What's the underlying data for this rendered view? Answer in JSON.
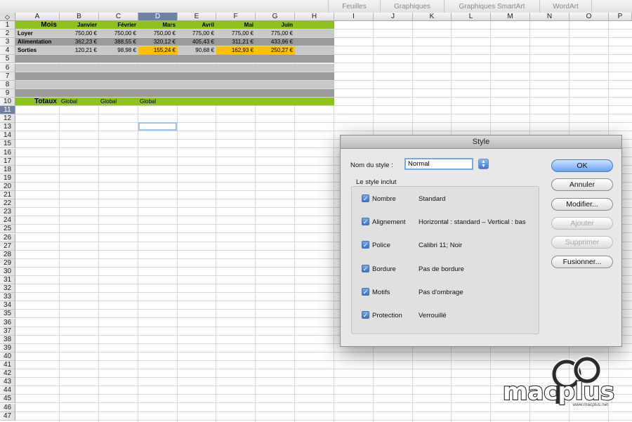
{
  "ribbon": {
    "tabs": [
      "Feuilles",
      "Graphiques",
      "Graphiques SmartArt",
      "WordArt"
    ]
  },
  "grid": {
    "corner_icon": "select-all-icon",
    "columns": [
      "A",
      "B",
      "C",
      "D",
      "E",
      "F",
      "G",
      "H",
      "I",
      "J",
      "K",
      "L",
      "M",
      "N",
      "O",
      "P"
    ],
    "selected_column": "D",
    "selected_row": "11",
    "rows": [
      "1",
      "2",
      "3",
      "4",
      "5",
      "6",
      "7",
      "8",
      "9",
      "10",
      "11",
      "12",
      "13",
      "14",
      "15",
      "16",
      "17",
      "18",
      "19",
      "20",
      "21",
      "22",
      "23",
      "24",
      "25",
      "26",
      "27",
      "28",
      "29",
      "30",
      "31",
      "32",
      "33",
      "34",
      "35",
      "36",
      "37",
      "38",
      "39",
      "40",
      "41",
      "42",
      "43",
      "44",
      "45",
      "46",
      "47"
    ],
    "header_row": {
      "label": "Mois",
      "months": [
        "Janvier",
        "Février",
        "Mars",
        "Avril",
        "Mai",
        "Juin"
      ]
    },
    "data_rows": [
      {
        "label": "Loyer",
        "values": [
          "750,00 €",
          "750,00 €",
          "750,00 €",
          "775,00 €",
          "775,00 €",
          "775,00 €"
        ]
      },
      {
        "label": "Alimentation",
        "values": [
          "362,23 €",
          "388,55 €",
          "320,12 €",
          "405,43 €",
          "311,21 €",
          "433,96 €"
        ]
      },
      {
        "label": "Sorties",
        "values": [
          "120,21 €",
          "98,98 €",
          "155,24 €",
          "90,68 €",
          "162,93 €",
          "250,27 €"
        ]
      }
    ],
    "totals_row": {
      "label": "Totaux",
      "values": [
        "Global",
        "Global",
        "Global"
      ]
    }
  },
  "colors": {
    "accent_green": "#8dc21f",
    "highlight_yellow": "#ffc000",
    "band_dark": "#9b9b9b",
    "band_light": "#c8c8c8",
    "selection_blue": "#6f83a0"
  },
  "dialog": {
    "title": "Style",
    "name_label": "Nom du style :",
    "name_value": "Normal",
    "stepper_icon": "up-down-arrows-icon",
    "group_label": "Le style inclut",
    "items": [
      {
        "name": "Nombre",
        "value": "Standard",
        "checked": true
      },
      {
        "name": "Alignement",
        "value": "Horizontal : standard – Vertical : bas",
        "checked": true
      },
      {
        "name": "Police",
        "value": "Calibri 11; Noir",
        "checked": true
      },
      {
        "name": "Bordure",
        "value": "Pas de bordure",
        "checked": true
      },
      {
        "name": "Motifs",
        "value": "Pas d'ombrage",
        "checked": true
      },
      {
        "name": "Protection",
        "value": "Verrouillé",
        "checked": true
      }
    ],
    "buttons": {
      "ok": "OK",
      "cancel": "Annuler",
      "modify": "Modifier...",
      "add": "Ajouter",
      "delete": "Supprimer",
      "merge": "Fusionner..."
    }
  },
  "watermark": {
    "brand": "macplus",
    "url": "www.macplus.net"
  }
}
